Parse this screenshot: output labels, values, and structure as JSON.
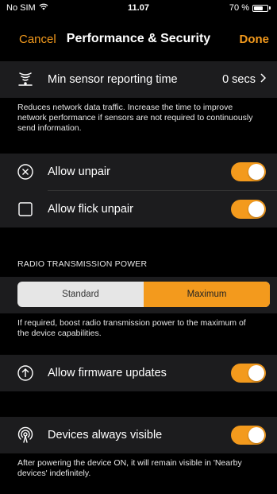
{
  "status_bar": {
    "carrier": "No SIM",
    "time": "11.07",
    "battery_text": "70 %",
    "battery_level": 0.7
  },
  "nav": {
    "cancel": "Cancel",
    "title": "Performance & Security",
    "done": "Done"
  },
  "sensor_row": {
    "label": "Min sensor reporting time",
    "value": "0 secs",
    "icon": "sensor-waves-icon"
  },
  "sensor_footer": "Reduces network data traffic. Increase the time to improve network performance if sensors are not required to continuously send information.",
  "unpair_rows": [
    {
      "label": "Allow unpair",
      "icon": "circle-x-icon",
      "on": true
    },
    {
      "label": "Allow flick unpair",
      "icon": "square-icon",
      "on": true
    }
  ],
  "radio": {
    "header": "RADIO TRANSMISSION POWER",
    "options": [
      "Standard",
      "Maximum"
    ],
    "selected": "Maximum",
    "footer": "If required, boost radio transmission power to the maximum of the device capabilities."
  },
  "firmware_row": {
    "label": "Allow firmware updates",
    "icon": "arrow-up-circle-icon",
    "on": true
  },
  "visible_row": {
    "label": "Devices always visible",
    "icon": "broadcast-icon",
    "on": true,
    "footer": "After powering the device ON, it will remain visible in 'Nearby devices' indefinitely."
  },
  "colors": {
    "accent": "#f39a1d",
    "row_bg": "#1c1c1e",
    "background": "#000000"
  }
}
